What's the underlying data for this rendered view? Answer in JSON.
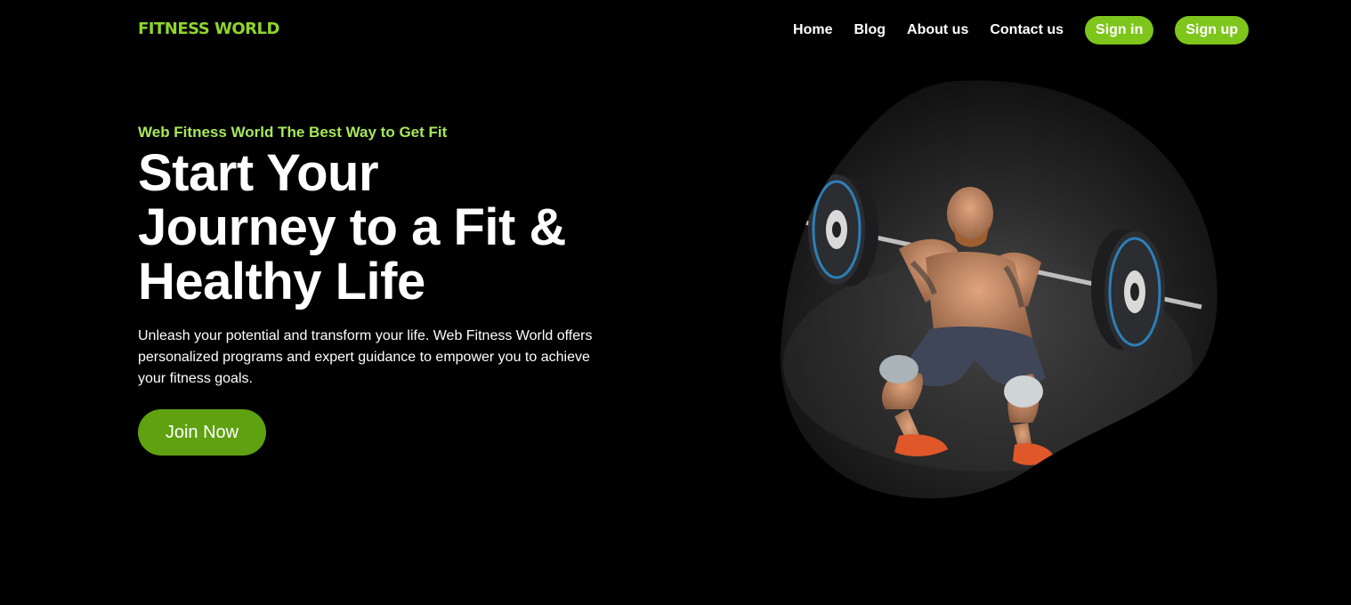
{
  "nav": {
    "logo": "FITNESS WORLD",
    "links": [
      "Home",
      "Blog",
      "About us",
      "Contact us"
    ],
    "sign_in": "Sign in",
    "sign_up": "Sign up"
  },
  "hero": {
    "tagline": "Web Fitness World The Best Way to Get Fit",
    "headline_line1": "Start Your",
    "headline_line2": "Journey to a Fit &",
    "headline_line3": "Healthy Life",
    "description": "Unleash your potential and transform your life. Web Fitness World offers personalized programs and expert guidance to empower you to achieve your fitness goals.",
    "cta": "Join Now"
  },
  "colors": {
    "accent": "#8fd62b",
    "tagline": "#a7e85a",
    "cta_bg": "#5fa111",
    "nav_btn_bg": "#7ec61c",
    "background": "#000000"
  },
  "icons": {
    "hero_image": "weightlifter-front-squat-illustration"
  }
}
